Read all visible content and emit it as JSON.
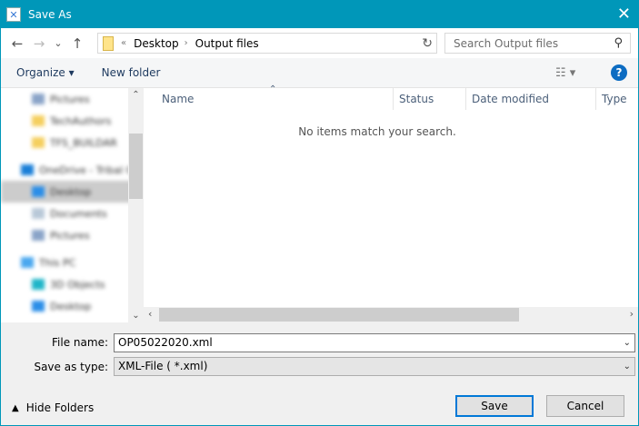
{
  "window": {
    "title": "Save As",
    "close": "✕"
  },
  "nav": {
    "back": "←",
    "forward": "→",
    "recent": "⌄",
    "up": "↑",
    "overflow": "«",
    "breadcrumbs": [
      "Desktop",
      "Output files"
    ],
    "refresh": "↻"
  },
  "search": {
    "placeholder": "Search Output files"
  },
  "toolbar": {
    "organize": "Organize ▾",
    "new_folder": "New folder",
    "view": "☷ ▾",
    "help": "?"
  },
  "sidebar": {
    "items": [
      {
        "label": "Pictures",
        "icon": "pictures-icon"
      },
      {
        "label": "TechAuthors",
        "icon": "folder-icon"
      },
      {
        "label": "TFS_BUILDAR",
        "icon": "folder-icon"
      },
      {
        "label": "OneDrive - Tribal G",
        "icon": "cloud-icon"
      },
      {
        "label": "Desktop",
        "icon": "desktop-icon",
        "selected": true
      },
      {
        "label": "Documents",
        "icon": "documents-icon"
      },
      {
        "label": "Pictures",
        "icon": "pictures-icon"
      },
      {
        "label": "This PC",
        "icon": "computer-icon"
      },
      {
        "label": "3D Objects",
        "icon": "3d-objects-icon"
      },
      {
        "label": "Desktop",
        "icon": "desktop-icon"
      }
    ]
  },
  "columns": [
    "Name",
    "Status",
    "Date modified",
    "Type"
  ],
  "empty_message": "No items match your search.",
  "form": {
    "file_name_label": "File name:",
    "file_name": "OP05022020.xml",
    "type_label": "Save as type:",
    "type": "XML-File  ( *.xml)"
  },
  "footer": {
    "hide_folders": "Hide Folders",
    "save": "Save",
    "cancel": "Cancel"
  },
  "colors": {
    "titlebar": "#0097b9",
    "accent": "#0078d7"
  }
}
